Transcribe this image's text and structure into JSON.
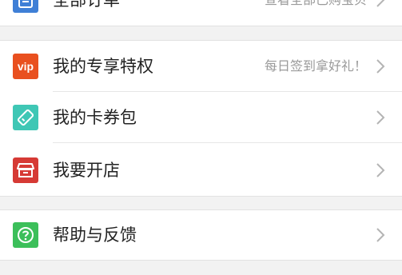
{
  "orders": {
    "label": "全部订单",
    "hint": "查看全部已购宝贝"
  },
  "menu": [
    {
      "label": "我的专享特权",
      "hint": "每日签到拿好礼！",
      "icon": "vip-icon",
      "icon_text": "vip",
      "color": "#e9501f"
    },
    {
      "label": "我的卡券包",
      "hint": "",
      "icon": "ticket-icon",
      "color": "#3fc7b5"
    },
    {
      "label": "我要开店",
      "hint": "",
      "icon": "shop-icon",
      "color": "#d63a35"
    }
  ],
  "help": {
    "label": "帮助与反馈",
    "icon": "help-icon",
    "color": "#3cbf5a"
  }
}
